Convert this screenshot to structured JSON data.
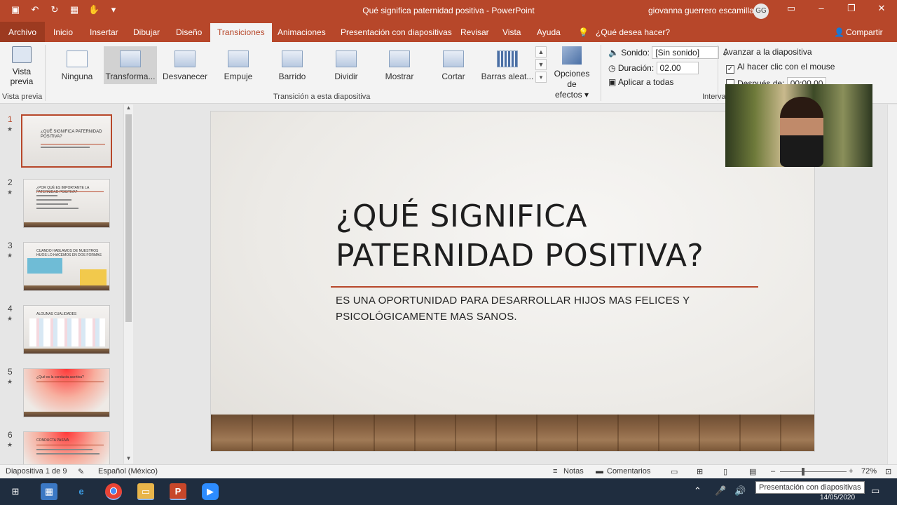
{
  "window": {
    "title": "Qué significa paternidad positiva  -  PowerPoint",
    "user": "giovanna guerrero escamilla",
    "user_initials": "GG",
    "controls": {
      "minimize": "–",
      "restore": "❐",
      "close": "✕"
    }
  },
  "quick_access": [
    {
      "name": "save-icon",
      "glyph": "💾"
    },
    {
      "name": "undo-icon",
      "glyph": "↶"
    },
    {
      "name": "redo-icon",
      "glyph": "↻"
    },
    {
      "name": "present-icon",
      "glyph": "▦"
    },
    {
      "name": "touch-icon",
      "glyph": "✋"
    },
    {
      "name": "customize-icon",
      "glyph": "▾"
    }
  ],
  "menu": {
    "file": "Archivo",
    "tabs": [
      "Inicio",
      "Insertar",
      "Dibujar",
      "Diseño",
      "Transiciones",
      "Animaciones",
      "Presentación con diapositivas",
      "Revisar",
      "Vista",
      "Ayuda"
    ],
    "active_tab": "Transiciones",
    "search": "¿Qué desea hacer?",
    "share": "Compartir"
  },
  "ribbon": {
    "preview_label_1": "Vista",
    "preview_label_2": "previa",
    "preview_group": "Vista previa",
    "transitions": [
      "Ninguna",
      "Transforma...",
      "Desvanecer",
      "Empuje",
      "Barrido",
      "Dividir",
      "Mostrar",
      "Cortar",
      "Barras aleat..."
    ],
    "selected_transition": "Transforma...",
    "effect_options_1": "Opciones de",
    "effect_options_2": "efectos ▾",
    "transition_group": "Transición a esta diapositiva",
    "sound_label": "Sonido:",
    "sound_value": "[Sin sonido]",
    "duration_label": "Duración:",
    "duration_value": "02.00",
    "apply_all": "Aplicar a todas",
    "advance_label": "Avanzar a la diapositiva",
    "on_click": "Al hacer clic con el mouse",
    "on_click_checked": true,
    "after_label": "Después de:",
    "after_value": "00:00.00",
    "timing_group": "Interva"
  },
  "slides": [
    {
      "num": "1",
      "title": "¿QUÉ SIGNIFICA PATERNIDAD POSITIVA?"
    },
    {
      "num": "2",
      "title": "¿POR QUÉ ES IMPORTANTE LA PATERNIDAD POSITIVA?"
    },
    {
      "num": "3",
      "title": "CUANDO HABLAMOS DE NUESTROS HIJOS LO HACEMOS EN DOS FORMAS"
    },
    {
      "num": "4",
      "title": "ALGUNAS CUALIDADES"
    },
    {
      "num": "5",
      "title": "¿Qué es la conducta asertiva?"
    },
    {
      "num": "6",
      "title": "CONDUCTA PASIVA"
    }
  ],
  "main_slide": {
    "title_line1": "¿QUÉ SIGNIFICA",
    "title_line2": "PATERNIDAD POSITIVA?",
    "subtitle_line1": "ES UNA OPORTUNIDAD PARA DESARROLLAR HIJOS MAS FELICES Y",
    "subtitle_line2": "PSICOLÓGICAMENTE MAS SANOS."
  },
  "status": {
    "slide_info": "Diapositiva 1 de 9",
    "language": "Español (México)",
    "notes": "Notas",
    "comments": "Comentarios",
    "zoom": "72%",
    "tooltip": "Presentación con diapositivas"
  },
  "taskbar": {
    "date": "14/05/2020",
    "apps": [
      "start-icon",
      "photos-icon",
      "edge-icon",
      "chrome-icon",
      "explorer-icon",
      "powerpoint-icon",
      "zoom-icon"
    ]
  },
  "colors": {
    "accent": "#b7472a",
    "ribbon_bg": "#f3f3f3",
    "taskbar_bg": "#1f2d3f"
  }
}
